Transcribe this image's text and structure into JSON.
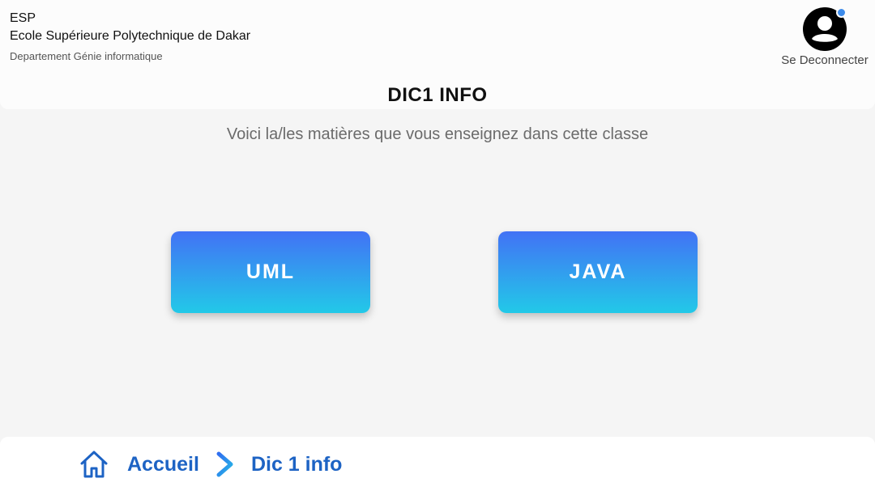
{
  "header": {
    "school_abbr": "ESP",
    "school_name": "Ecole Supérieure Polytechnique de Dakar",
    "department": "Departement Génie informatique",
    "user": {
      "avatar_icon": "account-circle-icon",
      "logout_label": "Se Deconnecter",
      "notification_color": "#3d8bea"
    }
  },
  "main": {
    "class_title": "DIC1 INFO",
    "subtitle": "Voici la/les matières que vous enseignez dans cette classe",
    "subjects": [
      {
        "label": "UML"
      },
      {
        "label": "JAVA"
      }
    ],
    "card_gradient": [
      "#4272f5",
      "#22c9e8"
    ]
  },
  "footer": {
    "breadcrumb": {
      "home_icon": "home-icon",
      "separator_icon": "chevron-right-icon",
      "home_label": "Accueil",
      "current_label": "Dic 1 info"
    },
    "accent_color": "#1d63c4"
  }
}
